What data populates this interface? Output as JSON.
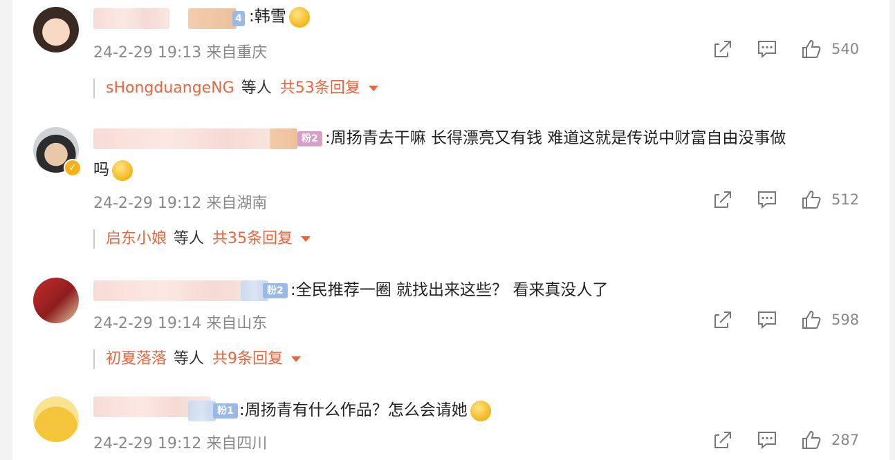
{
  "comments": [
    {
      "text": ":韩雪",
      "text_cont": "",
      "fan_badge": "",
      "time": "24-2-29 19:13",
      "location": "来自重庆",
      "likes": "540",
      "reply_user": "sHongduangeNG",
      "reply_etc": "等人",
      "reply_count": "共53条回复"
    },
    {
      "text": ":周扬青去干嘛 长得漂亮又有钱 难道这就是传说中财富自由没事做",
      "text_cont": "吗",
      "fan_badge": "粉2",
      "time": "24-2-29 19:12",
      "location": "来自湖南",
      "likes": "512",
      "reply_user": "启东小娘",
      "reply_etc": "等人",
      "reply_count": "共35条回复"
    },
    {
      "text": ":全民推荐一圈 就找出来这些？ 看来真没人了",
      "text_cont": "",
      "fan_badge": "粉2",
      "time": "24-2-29 19:14",
      "location": "来自山东",
      "likes": "598",
      "reply_user": "初夏落落",
      "reply_etc": "等人",
      "reply_count": "共9条回复"
    },
    {
      "text": ":周扬青有什么作品？怎么会请她",
      "text_cont": "",
      "fan_badge": "粉1",
      "time": "24-2-29 19:12",
      "location": "来自四川",
      "likes": "287",
      "reply_user": "",
      "reply_etc": "",
      "reply_count": ""
    }
  ],
  "icons": {
    "share": "share-icon",
    "comment": "comment-icon",
    "like": "thumbs-up-icon",
    "verified": "verified-badge-icon"
  },
  "colors": {
    "reply_accent": "#e8663e",
    "meta_gray": "#888888",
    "fan_badge_blue": "#9bb9e6"
  }
}
